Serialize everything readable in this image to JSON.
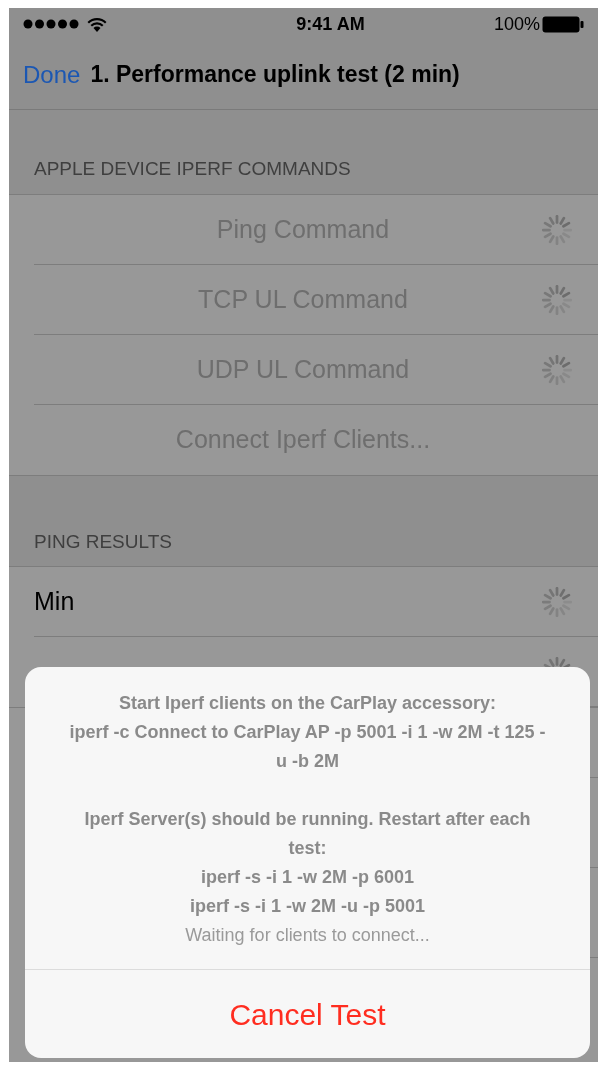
{
  "status_bar": {
    "time": "9:41 AM",
    "battery": "100%"
  },
  "nav_bar": {
    "back": "Done",
    "title": "1. Performance uplink test (2 min)"
  },
  "sections": [
    {
      "header": "APPLE DEVICE IPERF COMMANDS",
      "kind": "command",
      "rows": [
        {
          "label": "Ping Command",
          "loading": true
        },
        {
          "label": "TCP UL Command",
          "loading": true
        },
        {
          "label": "UDP UL Command",
          "loading": true
        },
        {
          "label": "Connect Iperf Clients...",
          "loading": false
        }
      ]
    },
    {
      "header": "PING RESULTS",
      "kind": "result",
      "rows": [
        {
          "label": "Min",
          "loading": true
        },
        {
          "loading": true
        }
      ]
    }
  ],
  "alert": {
    "messages": [
      "Start Iperf clients on the CarPlay accessory:",
      "iperf -c Connect to CarPlay AP -p 5001 -i 1 -w 2M -t 125 -u -b 2M",
      "Iperf Server(s) should be running. Restart after each test:",
      "iperf -s -i 1 -w 2M -p 6001",
      "iperf -s -i 1 -w 2M -u -p 5001"
    ],
    "status": "Waiting for clients to connect...",
    "button": "Cancel Test"
  }
}
